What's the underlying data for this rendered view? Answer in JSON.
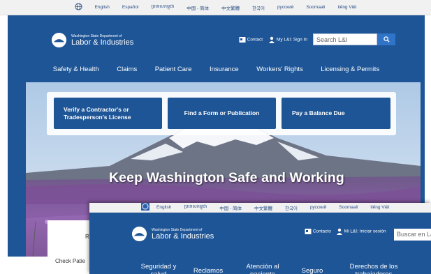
{
  "back_window": {
    "languages": [
      "English",
      "Español",
      "ប្រទេសកម្ពុជា",
      "中国 - 简体",
      "中文繁體",
      "한국어",
      "русский",
      "Soomaali",
      "tiếng Việt"
    ],
    "logo": {
      "line1": "Washington State Department of",
      "line2": "Labor & Industries"
    },
    "contact_label": "Contact",
    "signin_label": "My L&I: Sign In",
    "search_placeholder": "Search L&I",
    "nav": [
      "Safety & Health",
      "Claims",
      "Patient Care",
      "Insurance",
      "Workers' Rights",
      "Licensing & Permits"
    ],
    "buttons": {
      "contractor": [
        "Verify a Contractor's or",
        "Tradesperson's License"
      ],
      "form": "Find a Form or Publication",
      "balance": "Pay a Balance Due"
    },
    "headline": "Keep Washington Safe and Working",
    "card_peek": "R",
    "check_text": "Check Patie"
  },
  "front_window": {
    "languages": [
      "English",
      "ប្រទេសកម្ពុជា",
      "中国 - 简体",
      "中文繁體",
      "한국어",
      "русский",
      "Soomaali",
      "tiếng Việt"
    ],
    "logo": {
      "line1": "Washington State Department of",
      "line2": "Labor & Industries"
    },
    "contact_label": "Contacto",
    "signin_label": "Mi L&I: Iniciar sesión",
    "search_placeholder": "Buscar en L&",
    "nav": [
      {
        "line1": "Seguridad y",
        "line2": "salud"
      },
      {
        "line1": "Reclamos",
        "line2": ""
      },
      {
        "line1": "Atención al",
        "line2": "paciente"
      },
      {
        "line1": "Seguro",
        "line2": ""
      },
      {
        "line1": "Derechos de los",
        "line2": "trabajadores"
      }
    ]
  },
  "colors": {
    "brand": "#1e5596",
    "search_button": "#2f74c8",
    "lang_bar": "#f1f1f1"
  }
}
